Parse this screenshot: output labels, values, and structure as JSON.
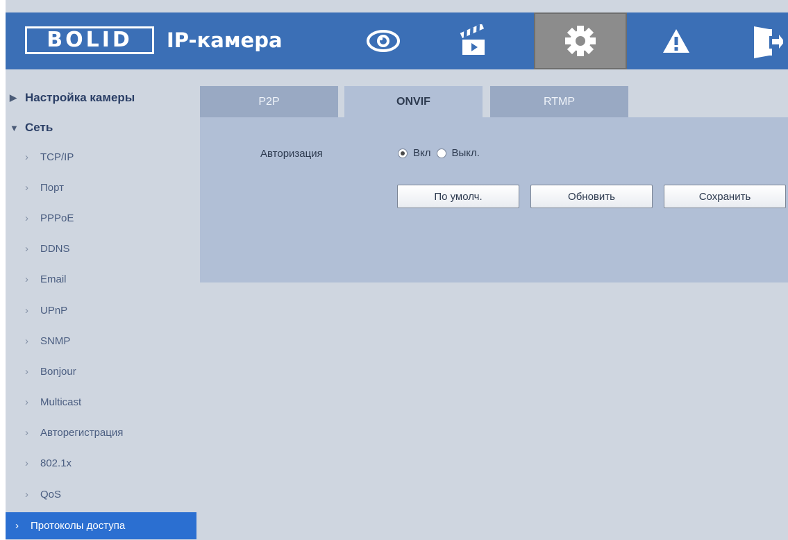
{
  "header": {
    "logo_text": "BOLID",
    "title": "IP-камера",
    "nav": [
      {
        "name": "live-view",
        "icon": "eye-icon"
      },
      {
        "name": "playback",
        "icon": "clapperboard-icon"
      },
      {
        "name": "settings",
        "icon": "gear-icon",
        "active": true
      },
      {
        "name": "alarm",
        "icon": "warning-icon"
      },
      {
        "name": "logout",
        "icon": "exit-door-icon"
      }
    ]
  },
  "sidebar": {
    "groups": [
      {
        "label": "Настройка камеры",
        "expanded": false
      },
      {
        "label": "Сеть",
        "expanded": true
      }
    ],
    "items": [
      {
        "label": "TCP/IP"
      },
      {
        "label": "Порт"
      },
      {
        "label": "PPPoE"
      },
      {
        "label": "DDNS"
      },
      {
        "label": "Email"
      },
      {
        "label": "UPnP"
      },
      {
        "label": "SNMP"
      },
      {
        "label": "Bonjour"
      },
      {
        "label": "Multicast"
      },
      {
        "label": "Авторегистрация"
      },
      {
        "label": "802.1x"
      },
      {
        "label": "QoS"
      },
      {
        "label": "Протоколы доступа",
        "selected": true
      }
    ]
  },
  "tabs": [
    {
      "label": "P2P",
      "active": false
    },
    {
      "label": "ONVIF",
      "active": true
    },
    {
      "label": "RTMP",
      "active": false
    }
  ],
  "form": {
    "auth_label": "Авторизация",
    "radio_on_label": "Вкл",
    "radio_off_label": "Выкл.",
    "selected": "on"
  },
  "buttons": {
    "default_label": "По умолч.",
    "refresh_label": "Обновить",
    "save_label": "Сохранить"
  },
  "colors": {
    "header_blue": "#3b6fb6",
    "background": "#cfd6e0",
    "panel": "#b1bfd6",
    "tab_inactive": "#99a9c3",
    "selected_item": "#2b6fd1"
  }
}
